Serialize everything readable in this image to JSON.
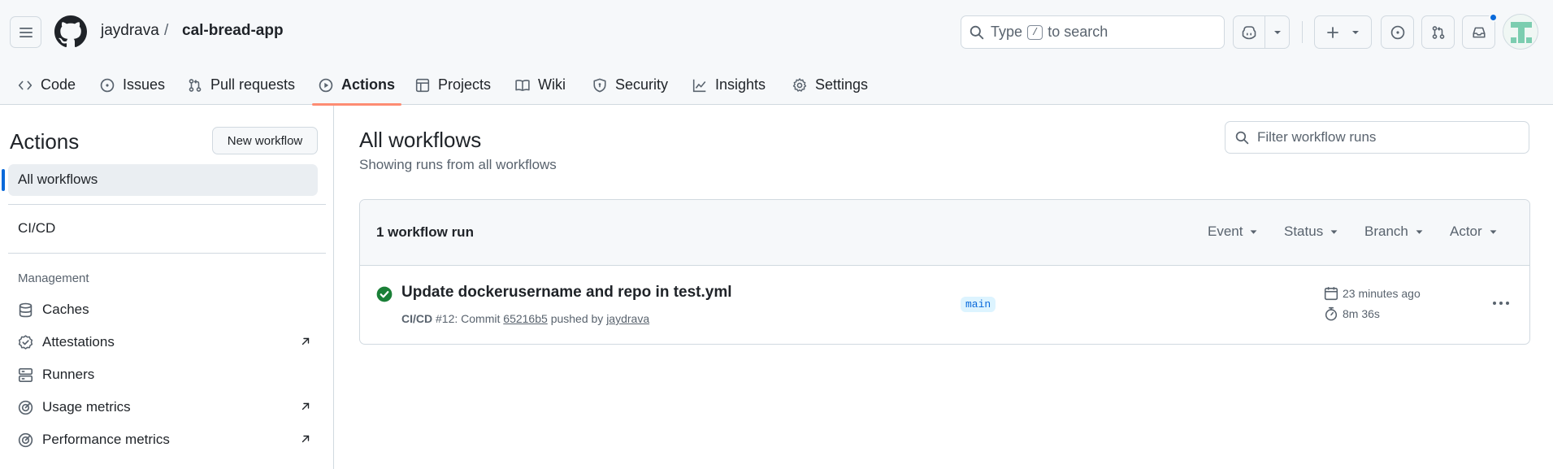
{
  "header": {
    "owner": "jaydrava",
    "separator": "/",
    "repo": "cal-bread-app",
    "search_prefix": "Type",
    "search_key": "/",
    "search_suffix": "to search",
    "notification_color": "#0969da"
  },
  "tabs": [
    {
      "label": "Code",
      "icon": "code-icon"
    },
    {
      "label": "Issues",
      "icon": "issue-opened-icon"
    },
    {
      "label": "Pull requests",
      "icon": "git-pull-request-icon"
    },
    {
      "label": "Actions",
      "icon": "play-icon",
      "active": true
    },
    {
      "label": "Projects",
      "icon": "table-icon"
    },
    {
      "label": "Wiki",
      "icon": "book-icon"
    },
    {
      "label": "Security",
      "icon": "shield-icon"
    },
    {
      "label": "Insights",
      "icon": "graph-icon"
    },
    {
      "label": "Settings",
      "icon": "gear-icon"
    }
  ],
  "sidebar": {
    "title": "Actions",
    "new_workflow": "New workflow",
    "all_workflows": "All workflows",
    "workflows": [
      "CI/CD"
    ],
    "management_label": "Management",
    "items": [
      {
        "label": "Caches",
        "icon": "database-icon",
        "external": false
      },
      {
        "label": "Attestations",
        "icon": "verified-icon",
        "external": true
      },
      {
        "label": "Runners",
        "icon": "server-icon",
        "external": false
      },
      {
        "label": "Usage metrics",
        "icon": "meter-icon",
        "external": true
      },
      {
        "label": "Performance metrics",
        "icon": "meter-icon",
        "external": true
      }
    ]
  },
  "main": {
    "title": "All workflows",
    "subtitle": "Showing runs from all workflows",
    "filter_placeholder": "Filter workflow runs",
    "runs_count": "1 workflow run",
    "filters": [
      "Event",
      "Status",
      "Branch",
      "Actor"
    ],
    "run": {
      "status": "success",
      "status_color": "#1a7f37",
      "title": "Update dockerusername and repo in test.yml",
      "workflow": "CI/CD",
      "run_number": "#12:",
      "commit_prefix": "Commit",
      "commit_sha": "65216b5",
      "pushed_by_prefix": "pushed by",
      "actor": "jaydrava",
      "branch": "main",
      "time_ago": "23 minutes ago",
      "duration": "8m 36s"
    }
  }
}
